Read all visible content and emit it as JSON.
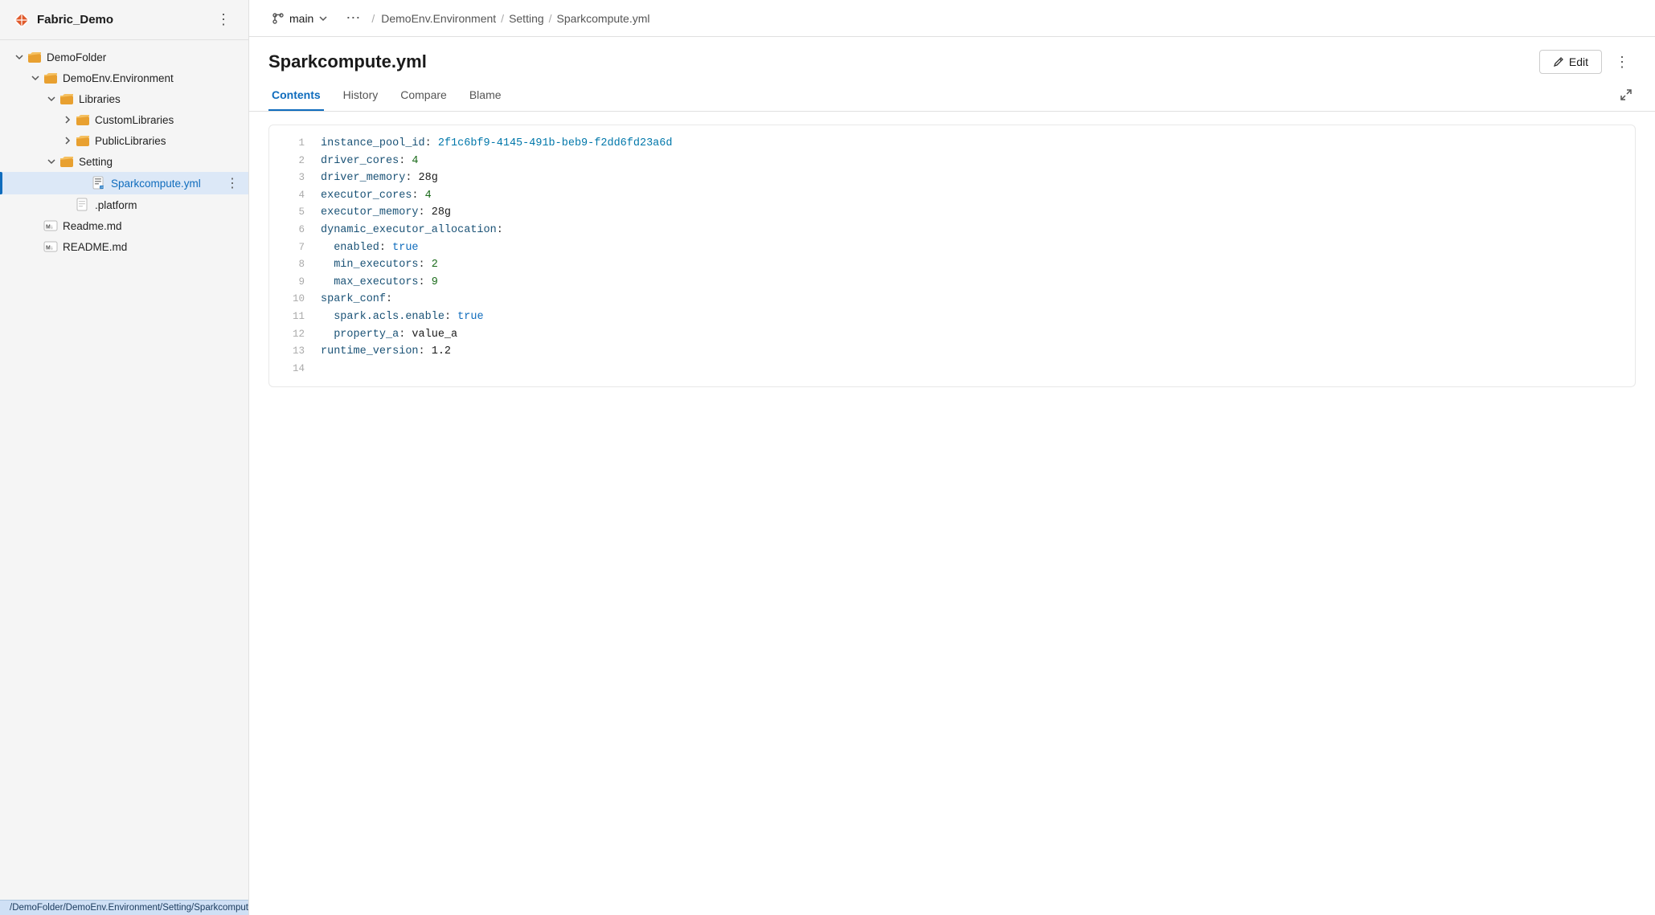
{
  "app": {
    "title": "Fabric_Demo"
  },
  "sidebar": {
    "more_label": "⋮",
    "tree": [
      {
        "id": "demofolder",
        "label": "DemoFolder",
        "type": "folder",
        "indent": 1,
        "chevron": "down",
        "active": false
      },
      {
        "id": "demoenv",
        "label": "DemoEnv.Environment",
        "type": "folder",
        "indent": 2,
        "chevron": "down",
        "active": false
      },
      {
        "id": "libraries",
        "label": "Libraries",
        "type": "folder",
        "indent": 3,
        "chevron": "down",
        "active": false
      },
      {
        "id": "customlibs",
        "label": "CustomLibraries",
        "type": "folder",
        "indent": 4,
        "chevron": "right",
        "active": false
      },
      {
        "id": "publiclibs",
        "label": "PublicLibraries",
        "type": "folder",
        "indent": 4,
        "chevron": "right",
        "active": false
      },
      {
        "id": "setting",
        "label": "Setting",
        "type": "folder",
        "indent": 3,
        "chevron": "down",
        "active": false
      },
      {
        "id": "sparkcompute",
        "label": "Sparkcompute.yml",
        "type": "file-yml",
        "indent": 5,
        "chevron": null,
        "active": true
      },
      {
        "id": "platform",
        "label": ".platform",
        "type": "file",
        "indent": 4,
        "chevron": null,
        "active": false
      },
      {
        "id": "readme-md",
        "label": "Readme.md",
        "type": "file-md",
        "indent": 2,
        "chevron": null,
        "active": false
      },
      {
        "id": "readme-cap",
        "label": "README.md",
        "type": "file-md",
        "indent": 2,
        "chevron": null,
        "active": false
      }
    ]
  },
  "topbar": {
    "branch": "main",
    "breadcrumb": [
      {
        "id": "demoenv-bc",
        "label": "DemoEnv.Environment"
      },
      {
        "id": "setting-bc",
        "label": "Setting"
      },
      {
        "id": "sparkcompute-bc",
        "label": "Sparkcompute.yml"
      }
    ]
  },
  "file": {
    "title": "Sparkcompute.yml",
    "edit_label": "Edit",
    "tabs": [
      {
        "id": "contents",
        "label": "Contents",
        "active": true
      },
      {
        "id": "history",
        "label": "History",
        "active": false
      },
      {
        "id": "compare",
        "label": "Compare",
        "active": false
      },
      {
        "id": "blame",
        "label": "Blame",
        "active": false
      }
    ]
  },
  "code": {
    "lines": [
      {
        "num": "1",
        "key": "instance_pool_id",
        "colon": ": ",
        "val": "2f1c6bf9-4145-491b-beb9-f2dd6fd23a6d",
        "val_type": "str"
      },
      {
        "num": "2",
        "key": "driver_cores",
        "colon": ": ",
        "val": "4",
        "val_type": "num"
      },
      {
        "num": "3",
        "key": "driver_memory",
        "colon": ": ",
        "val": "28g",
        "val_type": "plain"
      },
      {
        "num": "4",
        "key": "executor_cores",
        "colon": ": ",
        "val": "4",
        "val_type": "num"
      },
      {
        "num": "5",
        "key": "executor_memory",
        "colon": ": ",
        "val": "28g",
        "val_type": "plain"
      },
      {
        "num": "6",
        "key": "dynamic_executor_allocation",
        "colon": ":",
        "val": "",
        "val_type": "plain"
      },
      {
        "num": "7",
        "key": "  enabled",
        "colon": ": ",
        "val": "true",
        "val_type": "bool"
      },
      {
        "num": "8",
        "key": "  min_executors",
        "colon": ": ",
        "val": "2",
        "val_type": "num"
      },
      {
        "num": "9",
        "key": "  max_executors",
        "colon": ": ",
        "val": "9",
        "val_type": "num"
      },
      {
        "num": "10",
        "key": "spark_conf",
        "colon": ":",
        "val": "",
        "val_type": "plain"
      },
      {
        "num": "11",
        "key": "  spark.acls.enable",
        "colon": ": ",
        "val": "true",
        "val_type": "bool"
      },
      {
        "num": "12",
        "key": "  property_a",
        "colon": ": ",
        "val": "value_a",
        "val_type": "plain"
      },
      {
        "num": "13",
        "key": "runtime_version",
        "colon": ": ",
        "val": "1.2",
        "val_type": "plain"
      },
      {
        "num": "14",
        "key": "",
        "colon": "",
        "val": "",
        "val_type": "plain"
      }
    ]
  },
  "statusbar": {
    "text": "/DemoFolder/DemoEnv.Environment/Setting/Sparkcompute.yml&version=GBmain"
  }
}
